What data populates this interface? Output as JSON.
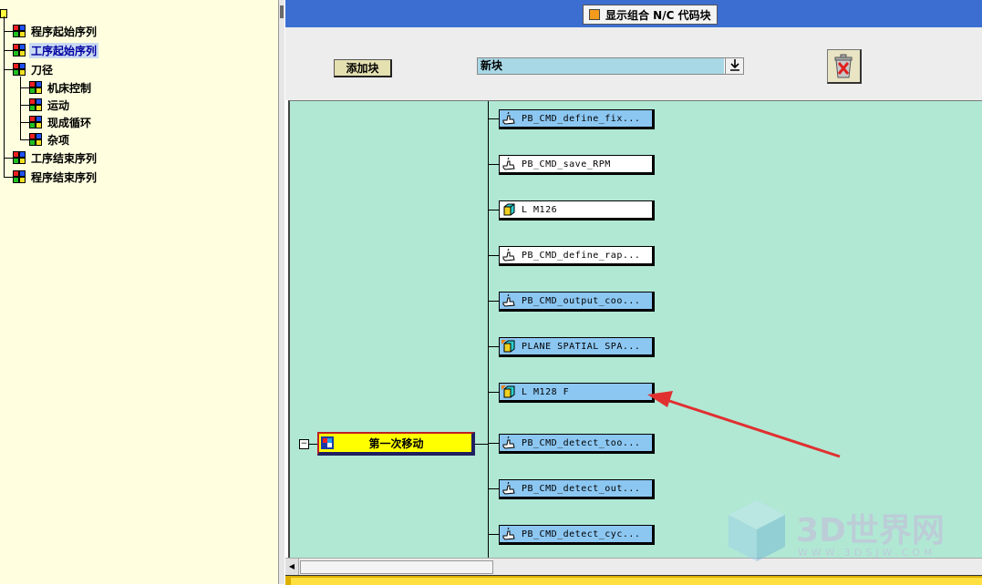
{
  "tree": {
    "items": [
      {
        "label": "程序起始序列",
        "level": 0
      },
      {
        "label": "工序起始序列",
        "level": 0,
        "selected": true
      },
      {
        "label": "刀径",
        "level": 0
      },
      {
        "label": "机床控制",
        "level": 1
      },
      {
        "label": "运动",
        "level": 1
      },
      {
        "label": "现成循环",
        "level": 1
      },
      {
        "label": "杂项",
        "level": 1
      },
      {
        "label": "工序结束序列",
        "level": 0
      },
      {
        "label": "程序结束序列",
        "level": 0
      }
    ]
  },
  "header": {
    "title": "显示组合 N/C 代码块"
  },
  "toolbar": {
    "add_block_label": "添加块",
    "new_block_value": "新块",
    "dropdown_icon": "download-arrow-icon",
    "delete_icon": "trash-icon"
  },
  "canvas": {
    "blocks": [
      {
        "label": "PB_CMD_define_fix...",
        "type": "command",
        "style": "blue"
      },
      {
        "label": "PB_CMD_save_RPM",
        "type": "command",
        "style": "white"
      },
      {
        "label": "L M126",
        "type": "block",
        "style": "white"
      },
      {
        "label": "PB_CMD_define_rap...",
        "type": "command",
        "style": "white"
      },
      {
        "label": "PB_CMD_output_coo...",
        "type": "command",
        "style": "blue"
      },
      {
        "label": "PLANE SPATIAL SPA...",
        "type": "block-flag",
        "style": "blue"
      },
      {
        "label": "L M128 F",
        "type": "block-flag",
        "style": "blue"
      },
      {
        "label": "PB_CMD_detect_too...",
        "type": "command",
        "style": "blue"
      },
      {
        "label": "PB_CMD_detect_out...",
        "type": "command",
        "style": "blue"
      },
      {
        "label": "PB_CMD_detect_cyc...",
        "type": "command",
        "style": "blue"
      }
    ],
    "event": {
      "label": "第一次移动",
      "collapse_symbol": "−"
    }
  },
  "watermark": {
    "brand": "3D世界网",
    "url": "WWW.3DSJW.COM"
  },
  "colors": {
    "canvas": "#b0e8d4",
    "topbar": "#3c6ed2",
    "tree_bg": "#ffffe0",
    "event": "#ffff00",
    "arrow": "#e03030"
  }
}
